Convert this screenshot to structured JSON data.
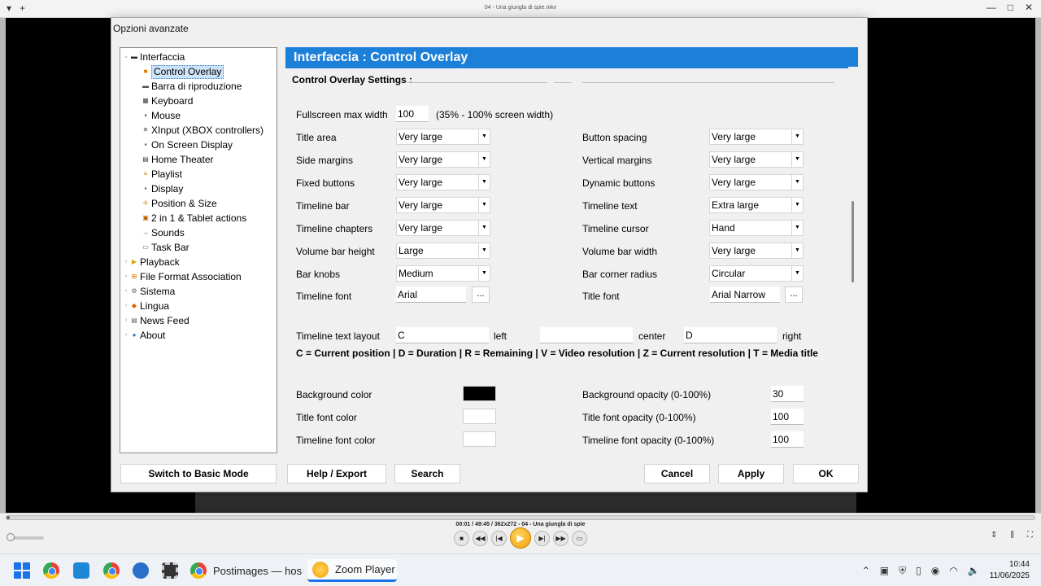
{
  "player": {
    "window_title": "04 - Una giungla di spie.mkv",
    "status": "00:01 / 49:45 / 362x272 - 04 - Una giungla di spie",
    "progress_fraction": 0.003
  },
  "dialog": {
    "title": "Opzioni avanzate",
    "header": "Interfaccia : Control Overlay",
    "section": "Control Overlay Settings :"
  },
  "tree": [
    {
      "label": "Interfaccia",
      "icon": "monitor-icon",
      "level": 0,
      "expanded": true
    },
    {
      "label": "Control Overlay",
      "icon": "overlay-icon",
      "level": 1,
      "selected": true
    },
    {
      "label": "Barra di riproduzione",
      "icon": "bar-icon",
      "level": 1
    },
    {
      "label": "Keyboard",
      "icon": "keyboard-icon",
      "level": 1
    },
    {
      "label": "Mouse",
      "icon": "mouse-icon",
      "level": 1
    },
    {
      "label": "XInput (XBOX controllers)",
      "icon": "gamepad-icon",
      "level": 1
    },
    {
      "label": "On Screen Display",
      "icon": "osd-icon",
      "level": 1
    },
    {
      "label": "Home Theater",
      "icon": "theater-icon",
      "level": 1
    },
    {
      "label": "Playlist",
      "icon": "playlist-icon",
      "level": 1
    },
    {
      "label": "Display",
      "icon": "display-icon",
      "level": 1
    },
    {
      "label": "Position & Size",
      "icon": "position-icon",
      "level": 1
    },
    {
      "label": "2 in 1 & Tablet actions",
      "icon": "tablet-icon",
      "level": 1
    },
    {
      "label": "Sounds",
      "icon": "sound-icon",
      "level": 1
    },
    {
      "label": "Task Bar",
      "icon": "taskbar-icon",
      "level": 1
    },
    {
      "label": "Playback",
      "icon": "playback-icon",
      "level": 0
    },
    {
      "label": "File Format Association",
      "icon": "file-format-icon",
      "level": 0
    },
    {
      "label": "Sistema",
      "icon": "gear-icon",
      "level": 0
    },
    {
      "label": "Lingua",
      "icon": "language-icon",
      "level": 0
    },
    {
      "label": "News Feed",
      "icon": "news-icon",
      "level": 0
    },
    {
      "label": "About",
      "icon": "info-icon",
      "level": 0
    }
  ],
  "settings": {
    "fullscreen_max_width_label": "Fullscreen max width",
    "fullscreen_max_width_value": "100",
    "fullscreen_max_width_hint": "(35% - 100% screen width)",
    "left_rows": [
      {
        "label": "Title area",
        "value": "Very large"
      },
      {
        "label": "Side margins",
        "value": "Very large"
      },
      {
        "label": "Fixed buttons",
        "value": "Very large"
      },
      {
        "label": "Timeline bar",
        "value": "Very large"
      },
      {
        "label": "Timeline chapters",
        "value": "Very large"
      },
      {
        "label": "Volume bar height",
        "value": "Large"
      },
      {
        "label": "Bar knobs",
        "value": "Medium"
      }
    ],
    "right_rows": [
      {
        "label": "Button spacing",
        "value": "Very large"
      },
      {
        "label": "Vertical margins",
        "value": "Very large"
      },
      {
        "label": "Dynamic buttons",
        "value": "Very large"
      },
      {
        "label": "Timeline text",
        "value": "Extra large"
      },
      {
        "label": "Timeline cursor",
        "value": "Hand"
      },
      {
        "label": "Volume bar width",
        "value": "Very large"
      },
      {
        "label": "Bar corner radius",
        "value": "Circular"
      }
    ],
    "timeline_font_label": "Timeline font",
    "timeline_font_value": "Arial",
    "title_font_label": "Title font",
    "title_font_value": "Arial Narrow",
    "dots": "...",
    "layout_label": "Timeline text layout",
    "layout_left_value": "C",
    "layout_left_label": "left",
    "layout_center_value": "",
    "layout_center_label": "center",
    "layout_right_value": "D",
    "layout_right_label": "right",
    "layout_legend": "C = Current position   |   D = Duration   |   R = Remaining   |   V = Video resolution   |   Z = Current resolution   |   T = Media title",
    "bg_color_label": "Background color",
    "bg_color": "#000000",
    "title_font_color_label": "Title font color",
    "title_font_color": "#ffffff",
    "timeline_font_color_label": "Timeline font color",
    "timeline_font_color": "#ffffff",
    "bg_opacity_label": "Background opacity (0-100%)",
    "bg_opacity_value": "30",
    "title_opacity_label": "Title font opacity (0-100%)",
    "title_opacity_value": "100",
    "timeline_opacity_label": "Timeline font opacity (0-100%)",
    "timeline_opacity_value": "100"
  },
  "buttons": {
    "basic_mode": "Switch to Basic Mode",
    "help_export": "Help / Export",
    "search": "Search",
    "cancel": "Cancel",
    "apply": "Apply",
    "ok": "OK"
  },
  "taskbar": {
    "postimages": "Postimages — hos",
    "zoom_player": "Zoom Player",
    "time": "10:44",
    "date": "11/06/2025"
  },
  "colors": {
    "header_blue": "#1c7fd8",
    "selection": "#cce4f7",
    "play_orange": "#f2a10b"
  }
}
